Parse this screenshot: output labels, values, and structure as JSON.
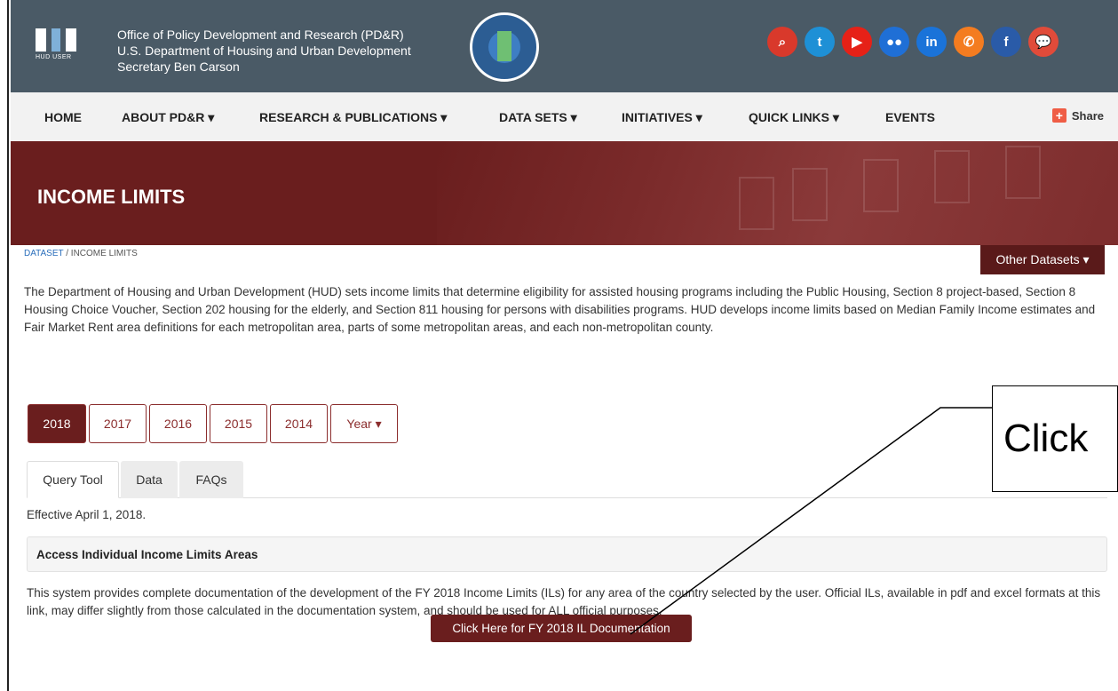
{
  "header": {
    "logo_caption": "HUD USER",
    "office_line1": "Office of Policy Development and Research (PD&R)",
    "office_line2": "U.S. Department of Housing and Urban Development",
    "office_line3": "Secretary Ben Carson",
    "social_icons": [
      {
        "name": "search-icon",
        "glyph": "⌕",
        "color": "#d9392b"
      },
      {
        "name": "twitter-icon",
        "glyph": "t",
        "color": "#1e90d6"
      },
      {
        "name": "youtube-icon",
        "glyph": "▶",
        "color": "#e62117"
      },
      {
        "name": "flickr-icon",
        "glyph": "●●",
        "color": "#1f6fd6"
      },
      {
        "name": "linkedin-icon",
        "glyph": "in",
        "color": "#1a73d9"
      },
      {
        "name": "phone-icon",
        "glyph": "✆",
        "color": "#f47c20"
      },
      {
        "name": "facebook-icon",
        "glyph": "f",
        "color": "#2a5ba8"
      },
      {
        "name": "chat-icon",
        "glyph": "💬",
        "color": "#e04b3a"
      }
    ]
  },
  "nav": {
    "items": [
      "HOME",
      "ABOUT PD&R ▾",
      "RESEARCH & PUBLICATIONS ▾",
      "DATA SETS ▾",
      "INITIATIVES ▾",
      "QUICK LINKS ▾",
      "EVENTS"
    ],
    "share_label": "Share"
  },
  "banner": {
    "title": "INCOME LIMITS"
  },
  "breadcrumb": {
    "root": "DATASET",
    "sep": " / ",
    "current": "INCOME LIMITS"
  },
  "other_datasets_label": "Other Datasets ▾",
  "intro_text": "The Department of Housing and Urban Development (HUD) sets income limits that determine eligibility for assisted housing programs including the Public Housing, Section 8 project-based, Section 8 Housing Choice Voucher, Section 202 housing for the elderly, and Section 811 housing for persons with disabilities programs. HUD develops income limits based on Median Family Income estimates and Fair Market Rent area definitions for each metropolitan area, parts of some metropolitan areas, and each non-metropolitan county.",
  "years": {
    "tabs": [
      "2018",
      "2017",
      "2016",
      "2015",
      "2014",
      "Year ▾"
    ],
    "active": "2018"
  },
  "callout": {
    "label": "Click"
  },
  "content_tabs": [
    "Query Tool",
    "Data",
    "FAQs"
  ],
  "effective": "Effective April 1, 2018.",
  "access_heading": "Access Individual Income Limits Areas",
  "system_text": "This system provides complete documentation of the development of the FY 2018 Income Limits (ILs) for any area of the country selected by the user. Official ILs, available in pdf and excel formats at this link, may differ slightly from those calculated in the documentation system, and should be used for ALL official purposes.",
  "doc_button_label": "Click Here for FY 2018 IL Documentation",
  "colors": {
    "accent": "#6a1e1e",
    "header_bg": "#4a5a66",
    "nav_bg": "#f2f2f2"
  }
}
